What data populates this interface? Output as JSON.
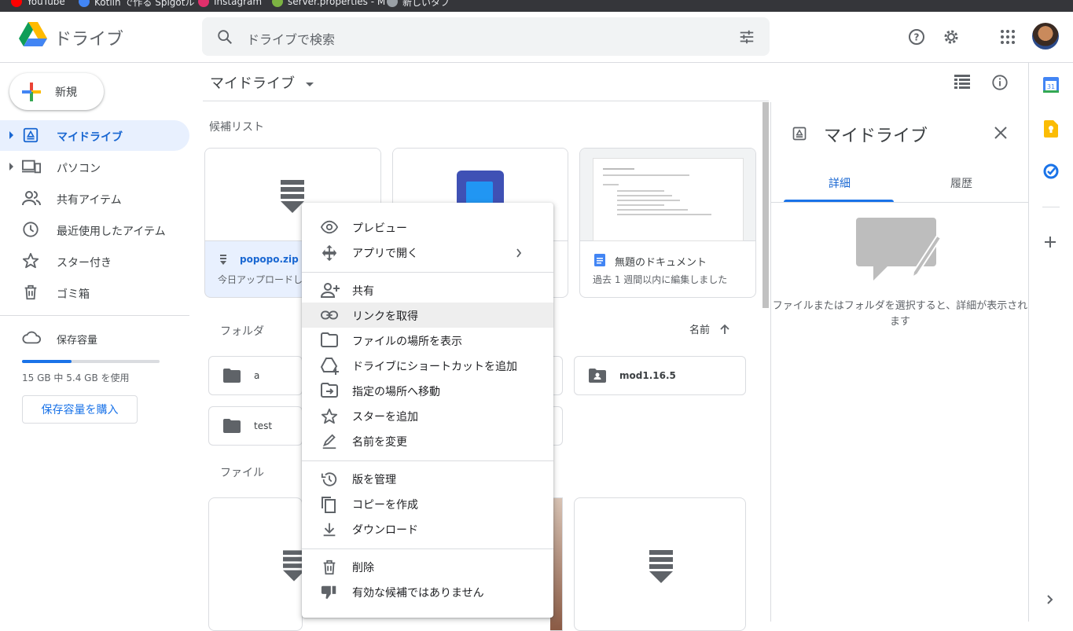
{
  "bookmarks": [
    {
      "label": "YouTube",
      "color": "#ff0000"
    },
    {
      "label": "Kotlin で作る Spigotル",
      "color": "#4285f4"
    },
    {
      "label": "Instagram",
      "color": "#e1306c"
    },
    {
      "label": "server.properties - M",
      "color": "#7cb342"
    },
    {
      "label": "新しいタブ",
      "color": "#9aa0a6"
    }
  ],
  "header": {
    "app_name": "ドライブ",
    "search_placeholder": "ドライブで検索"
  },
  "sidebar": {
    "new_label": "新規",
    "items": [
      {
        "label": "マイドライブ",
        "icon": "drive-icon",
        "active": true
      },
      {
        "label": "パソコン",
        "icon": "computer-icon"
      },
      {
        "label": "共有アイテム",
        "icon": "people-icon"
      },
      {
        "label": "最近使用したアイテム",
        "icon": "clock-icon"
      },
      {
        "label": "スター付き",
        "icon": "star-icon"
      },
      {
        "label": "ゴミ箱",
        "icon": "trash-icon"
      }
    ],
    "storage_label": "保存容量",
    "storage_used_text": "15 GB 中 5.4 GB を使用",
    "storage_fraction": 0.36,
    "buy_label": "保存容量を購入"
  },
  "main": {
    "title": "マイドライブ",
    "suggested_label": "候補リスト",
    "suggested": [
      {
        "name": "popopo.zip",
        "sub": "今日アップロードし"
      },
      {
        "name": "",
        "sub": ""
      },
      {
        "name": "無題のドキュメント",
        "sub": "過去 1 週間以内に編集しました"
      }
    ],
    "folders_label": "フォルダ",
    "sort_label": "名前",
    "folders": [
      "a",
      "mod1.16.5",
      "test"
    ],
    "files_label": "ファイル"
  },
  "context_menu": {
    "items": [
      {
        "label": "プレビュー",
        "icon": "eye-icon"
      },
      {
        "label": "アプリで開く",
        "icon": "move-icon"
      },
      {
        "label": "共有",
        "icon": "person-add-icon"
      },
      {
        "label": "リンクを取得",
        "icon": "link-icon"
      },
      {
        "label": "ファイルの場所を表示",
        "icon": "folder-outline-icon"
      },
      {
        "label": "ドライブにショートカットを追加",
        "icon": "drive-shortcut-icon"
      },
      {
        "label": "指定の場所へ移動",
        "icon": "move-to-icon"
      },
      {
        "label": "スターを追加",
        "icon": "star-icon"
      },
      {
        "label": "名前を変更",
        "icon": "rename-icon"
      },
      {
        "label": "版を管理",
        "icon": "history-icon"
      },
      {
        "label": "コピーを作成",
        "icon": "copy-icon"
      },
      {
        "label": "ダウンロード",
        "icon": "download-icon"
      },
      {
        "label": "削除",
        "icon": "trash-icon"
      },
      {
        "label": "有効な候補ではありません",
        "icon": "thumb-down-icon"
      }
    ]
  },
  "details": {
    "title": "マイドライブ",
    "tabs": [
      "詳細",
      "履歴"
    ],
    "empty_text": "ファイルまたはフォルダを選択すると、詳細が表示されます"
  },
  "colors": {
    "accent": "#1a73e8",
    "active_bg": "#e8f0fe"
  }
}
